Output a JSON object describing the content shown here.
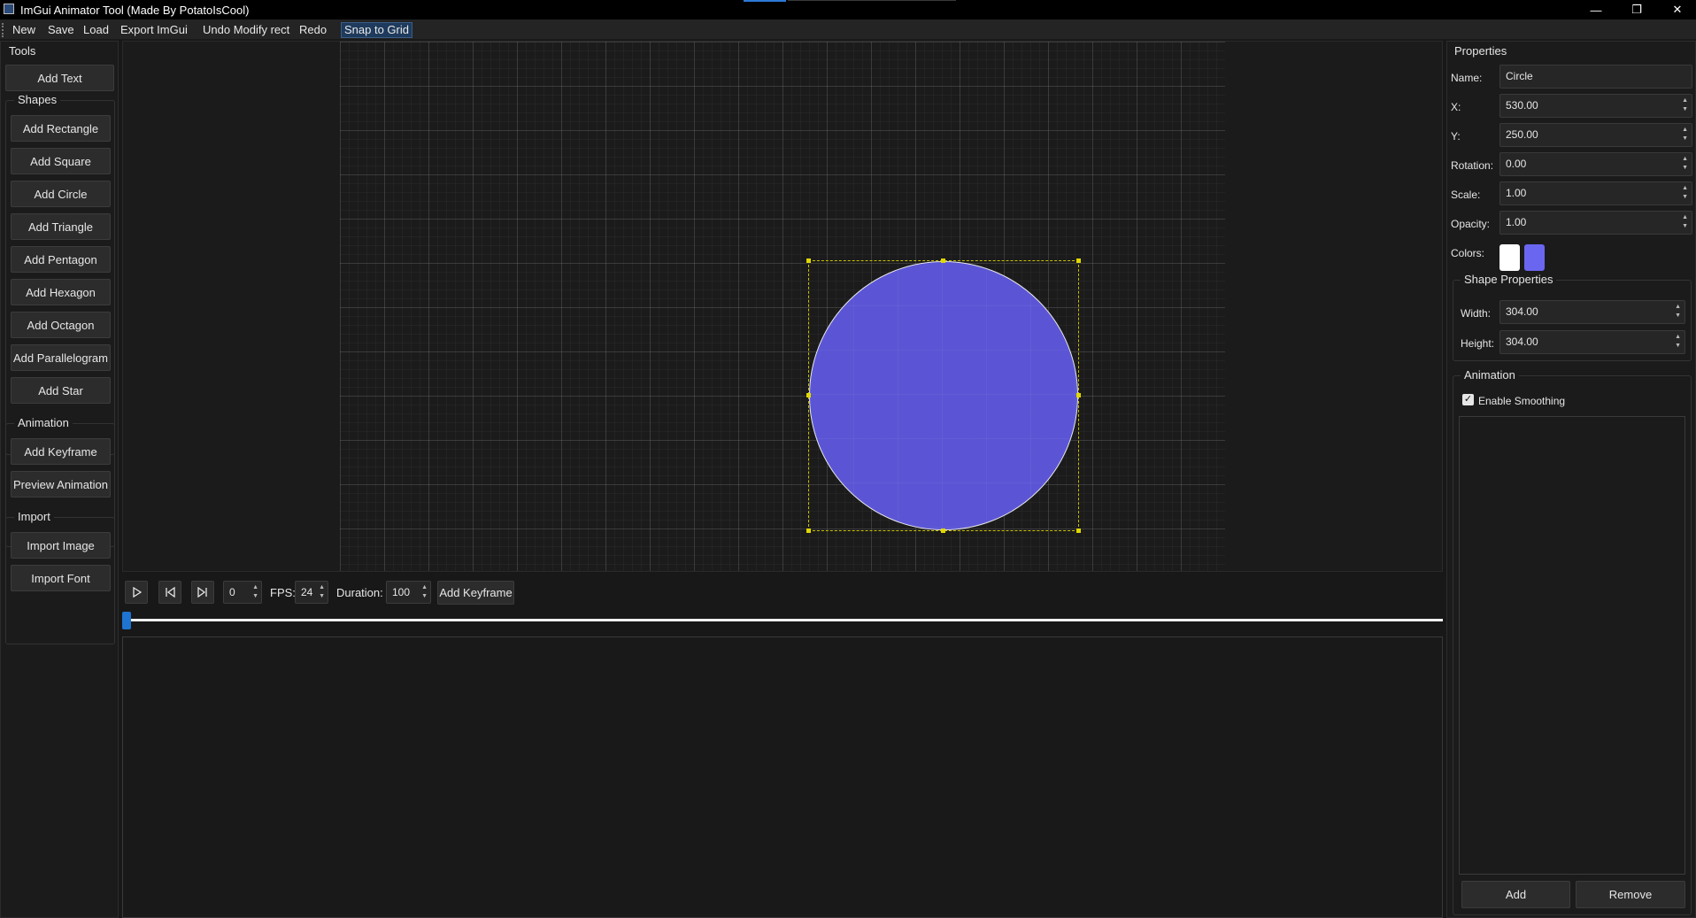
{
  "window": {
    "title": "ImGui Animator Tool (Made By PotatoIsCool)",
    "minimize_glyph": "—",
    "maximize_glyph": "❐",
    "close_glyph": "✕"
  },
  "menu": {
    "items": [
      "New",
      "Save",
      "Load",
      "Export ImGui",
      "Undo Modify rect",
      "Redo",
      "Snap to Grid"
    ],
    "active": "Snap to Grid"
  },
  "tools": {
    "title": "Tools",
    "add_text": "Add Text",
    "shapes_title": "Shapes",
    "shapes": [
      "Add Rectangle",
      "Add Square",
      "Add Circle",
      "Add Triangle",
      "Add Pentagon",
      "Add Hexagon",
      "Add Octagon",
      "Add Parallelogram",
      "Add Star"
    ],
    "animation_title": "Animation",
    "animation": [
      "Add Keyframe",
      "Preview Animation"
    ],
    "import_title": "Import",
    "import": [
      "Import Image",
      "Import Font"
    ]
  },
  "canvas": {
    "selected_shape": "circle",
    "fill_color": "#5b55d6",
    "outline_color": "#e8e8e8",
    "selection_color": "#c8c000",
    "snap_to_grid": true
  },
  "timeline": {
    "play_icon": "play-icon",
    "prev_icon": "skip-back-icon",
    "next_icon": "skip-forward-icon",
    "frame": "0",
    "fps_label": "FPS:",
    "fps": "24",
    "duration_label": "Duration:",
    "duration": "100",
    "add_keyframe": "Add Keyframe",
    "progress": 0
  },
  "properties": {
    "title": "Properties",
    "name_label": "Name:",
    "name": "Circle",
    "x_label": "X:",
    "x": "530.00",
    "y_label": "Y:",
    "y": "250.00",
    "rotation_label": "Rotation:",
    "rotation": "0.00",
    "scale_label": "Scale:",
    "scale": "1.00",
    "opacity_label": "Opacity:",
    "opacity": "1.00",
    "colors_label": "Colors:",
    "color1": "#ffffff",
    "color2": "#6b66f0",
    "shape_props_title": "Shape Properties",
    "width_label": "Width:",
    "width": "304.00",
    "height_label": "Height:",
    "height": "304.00",
    "animation_title": "Animation",
    "smoothing_label": "Enable Smoothing",
    "smoothing": true,
    "add": "Add",
    "remove": "Remove"
  }
}
